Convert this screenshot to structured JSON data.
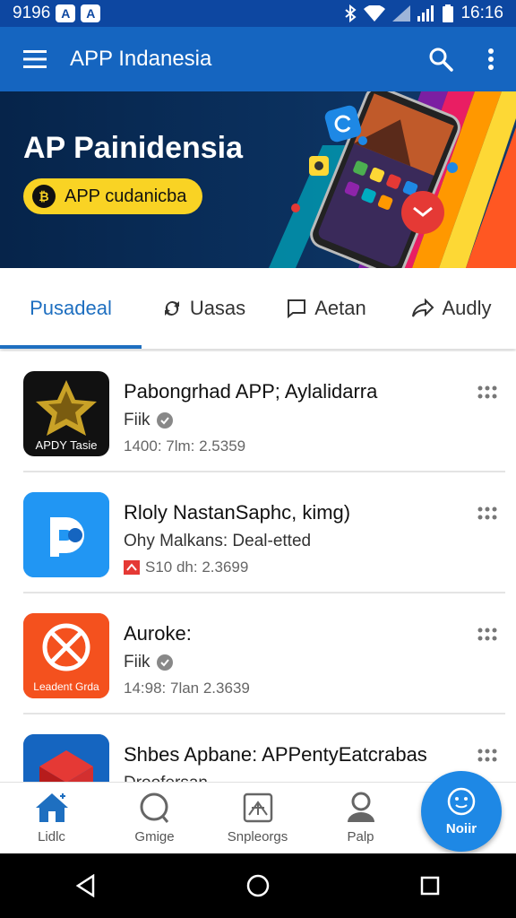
{
  "status_bar": {
    "time_left": "9196",
    "clock": "16:16"
  },
  "app_bar": {
    "title": "APP Indanesia"
  },
  "banner": {
    "title": "AP Painidensia",
    "cta_label": "APP cudanicba",
    "cta_icon": "₿"
  },
  "tabs": [
    {
      "label": "Pusadeal",
      "icon": "none",
      "active": true
    },
    {
      "label": "Uasas",
      "icon": "sync-icon"
    },
    {
      "label": "Aetan",
      "icon": "chat-icon"
    },
    {
      "label": "Audly",
      "icon": "share-icon"
    }
  ],
  "apps": [
    {
      "title": "Pabongrhad APP;  Aylalidarra",
      "subtitle": "Fiik",
      "meta": "1400: 7lm: 2.5359",
      "icon_label": "APDY Tasie",
      "icon_color": "#111111"
    },
    {
      "title": "Rloly NastanSaphc, kimg)",
      "subtitle": "Ohy Malkans: Deal-etted",
      "meta": "S10 dh: 2.3699",
      "icon_label": "",
      "icon_color": "#1e88e5"
    },
    {
      "title": "Auroke:",
      "subtitle": "Fiik",
      "meta": "14:98: 7lan 2.3639",
      "icon_label": "Leadent Grda",
      "icon_color": "#e53935"
    },
    {
      "title": "Shbes Apbane: APPentyEatcrabas",
      "subtitle": "Droofersan",
      "meta": "",
      "icon_label": "",
      "icon_color": "#1565c0"
    }
  ],
  "bottom_nav": [
    {
      "label": "Lidlc",
      "icon": "home-icon"
    },
    {
      "label": "Gmige",
      "icon": "search-circle-icon"
    },
    {
      "label": "Snplеorgs",
      "icon": "tent-icon"
    },
    {
      "label": "Palp",
      "icon": "person-icon"
    }
  ],
  "fab": {
    "label": "Noiir"
  },
  "colors": {
    "primary": "#1565c0",
    "accent": "#1e88e5",
    "banner_bg": "#0a2f5c",
    "cta": "#f9d324"
  }
}
